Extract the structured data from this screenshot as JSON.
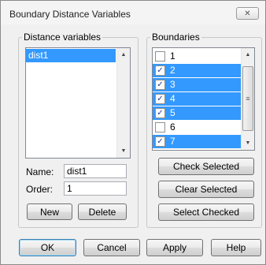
{
  "window": {
    "title": "Boundary Distance Variables",
    "close_glyph": "✕"
  },
  "distance": {
    "group_label": "Distance variables",
    "items": [
      "dist1"
    ],
    "name_label": "Name:",
    "name_value": "dist1",
    "order_label": "Order:",
    "order_value": "1",
    "new_label": "New",
    "delete_label": "Delete"
  },
  "boundaries": {
    "group_label": "Boundaries",
    "items": [
      {
        "label": "1",
        "checked": false,
        "selected": false
      },
      {
        "label": "2",
        "checked": true,
        "selected": true
      },
      {
        "label": "3",
        "checked": true,
        "selected": true
      },
      {
        "label": "4",
        "checked": true,
        "selected": true
      },
      {
        "label": "5",
        "checked": true,
        "selected": true
      },
      {
        "label": "6",
        "checked": false,
        "selected": false
      },
      {
        "label": "7",
        "checked": true,
        "selected": true
      }
    ],
    "check_selected_label": "Check Selected",
    "clear_selected_label": "Clear Selected",
    "select_checked_label": "Select Checked"
  },
  "footer": {
    "ok_label": "OK",
    "cancel_label": "Cancel",
    "apply_label": "Apply",
    "help_label": "Help"
  },
  "icons": {
    "up_arrow": "▲",
    "down_arrow": "▼",
    "grip": "≡",
    "check": "✓"
  }
}
